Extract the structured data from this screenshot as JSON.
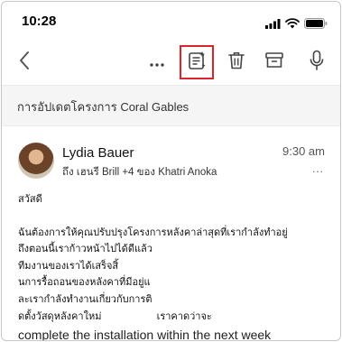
{
  "status_bar": {
    "time": "10:28"
  },
  "toolbar": {
    "icons": [
      "chevron-left-icon",
      "more-horizontal-icon",
      "summarize-icon",
      "trash-icon",
      "archive-icon",
      "microphone-icon"
    ],
    "highlight_color": "#d9252a"
  },
  "subject": "การอัปเดตโครงการ Coral Gables",
  "message": {
    "sender": "Lydia Bauer",
    "recipients": "ถึง เฮนรี Brill +4 ของ Khatri Anoka",
    "time": "9:30 am",
    "more": "...",
    "greeting": "สวัสดี",
    "lines": [
      "ฉันต้องการให้คุณปรับปรุงโครงการหลังคาล่าสุดที่เรากำลังทำอยู่",
      "ถึงตอนนี้เราก้าวหน้าไปได้ดีแล้ว",
      "ทีมงานของเราได้เสร็จสิ้",
      "นการรื้อถอนของหลังคาที่มีอยู่แ",
      "ละเรากำลังทำงานเกี่ยวกับการติ",
      "ดตั้งวัสดุหลังคาใหม่                    เราคาดว่าจะ"
    ],
    "overlay_line": "complete the installation within the next week"
  }
}
